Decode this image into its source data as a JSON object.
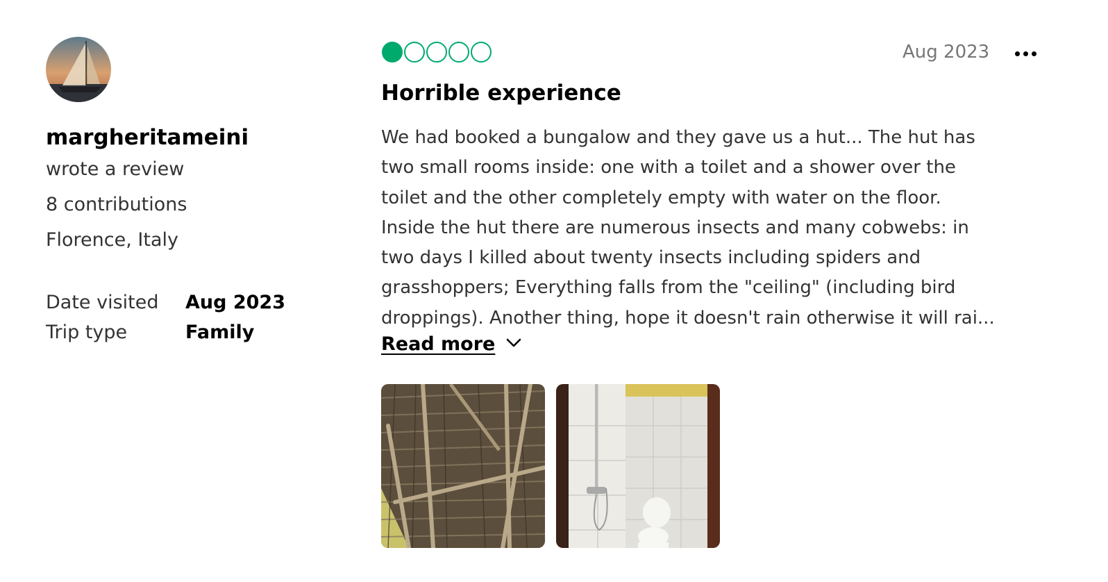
{
  "reviewer": {
    "username": "margheritameini",
    "action": "wrote a review",
    "contributions": "8 contributions",
    "location": "Florence, Italy"
  },
  "details": [
    {
      "label": "Date visited",
      "value": "Aug 2023"
    },
    {
      "label": "Trip type",
      "value": "Family"
    }
  ],
  "review": {
    "rating": 1,
    "rating_max": 5,
    "date": "Aug 2023",
    "title": "Horrible experience",
    "body_lines": [
      "We had booked a bungalow and they gave us a hut... The hut has",
      "two small rooms inside: one with a toilet and a shower over the",
      "toilet and the other completely empty with water on the floor.",
      "Inside the hut there are numerous insects and many cobwebs: in",
      "two days I killed about twenty insects including spiders and",
      "grasshoppers; Everything falls from the \"ceiling\" (including bird",
      "droppings). Another thing, hope it doesn't rain otherwise it will rai..."
    ],
    "read_more_label": "Read more"
  },
  "icons": {
    "more": "more-options-icon",
    "chevron": "chevron-down-icon",
    "rating": "rating-bubble-icon"
  },
  "colors": {
    "rating_green": "#00aa6c",
    "heading": "#000000",
    "body_text": "#333333",
    "muted_text": "#767676"
  }
}
